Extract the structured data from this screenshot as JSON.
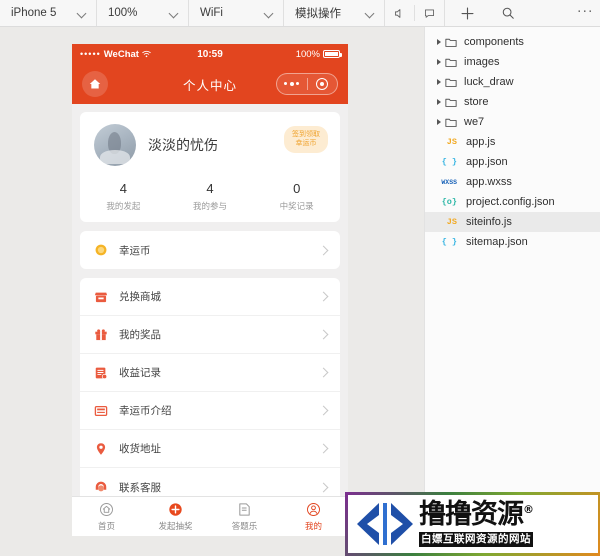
{
  "toolbar": {
    "device": "iPhone 5",
    "zoom": "100%",
    "network": "WiFi",
    "simulate": "模拟操作",
    "mute_icon": "speaker-mute-icon",
    "feedback_icon": "chat-bubble-icon",
    "add_icon": "plus-icon",
    "search_icon": "search-icon",
    "more_icon": "more-horizontal-icon"
  },
  "phone": {
    "status": {
      "signal_dots": "•••••",
      "carrier": "WeChat",
      "wifi_icon": "wifi-icon",
      "time": "10:59",
      "battery_percent": "100%",
      "battery_icon": "battery-full-icon"
    },
    "nav": {
      "home_icon": "home-icon",
      "title": "个人中心",
      "capsule_more_icon": "more-dots-icon",
      "capsule_target_icon": "target-circle-icon"
    },
    "user": {
      "avatar_icon": "user-avatar",
      "name": "淡淡的忧伤",
      "badge_line1": "签到领取",
      "badge_line2": "幸运币",
      "stats": [
        {
          "num": "4",
          "label": "我的发起"
        },
        {
          "num": "4",
          "label": "我的参与"
        },
        {
          "num": "0",
          "label": "中奖记录"
        }
      ]
    },
    "menu_group_1": [
      {
        "label": "幸运币",
        "icon": "coin-icon",
        "color": "#f5b426",
        "arrow_icon": "chevron-right-icon"
      }
    ],
    "menu_group_2": [
      {
        "label": "兑换商城",
        "icon": "shop-icon",
        "color": "#ea5b3f",
        "arrow_icon": "chevron-right-icon"
      },
      {
        "label": "我的奖品",
        "icon": "gift-icon",
        "color": "#ea5b3f",
        "arrow_icon": "chevron-right-icon"
      },
      {
        "label": "收益记录",
        "icon": "record-list-icon",
        "color": "#ea5b3f",
        "arrow_icon": "chevron-right-icon"
      },
      {
        "label": "幸运币介绍",
        "icon": "info-card-icon",
        "color": "#ea5b3f",
        "arrow_icon": "chevron-right-icon"
      },
      {
        "label": "收货地址",
        "icon": "location-pin-icon",
        "color": "#ea5b3f",
        "arrow_icon": "chevron-right-icon"
      },
      {
        "label": "联系客服",
        "icon": "headset-service-icon",
        "color": "#ea5b3f",
        "arrow_icon": "chevron-right-icon"
      }
    ],
    "tabs": [
      {
        "label": "首页",
        "icon": "home-outline-icon",
        "active": false
      },
      {
        "label": "发起抽奖",
        "icon": "plus-circle-icon",
        "active": false
      },
      {
        "label": "答题乐",
        "icon": "document-icon",
        "active": false
      },
      {
        "label": "我的",
        "icon": "person-circle-icon",
        "active": true
      }
    ]
  },
  "file_tree": [
    {
      "name": "components",
      "type": "folder",
      "icon": "folder-icon",
      "selected": false
    },
    {
      "name": "images",
      "type": "folder",
      "icon": "folder-icon",
      "selected": false
    },
    {
      "name": "luck_draw",
      "type": "folder",
      "icon": "folder-icon",
      "selected": false
    },
    {
      "name": "store",
      "type": "folder",
      "icon": "folder-icon",
      "selected": false
    },
    {
      "name": "we7",
      "type": "folder",
      "icon": "folder-icon",
      "selected": false
    },
    {
      "name": "app.js",
      "type": "file",
      "icon": "js-icon",
      "badge": "JS",
      "badge_color": "#f2ab26",
      "selected": false
    },
    {
      "name": "app.json",
      "type": "file",
      "icon": "json-icon",
      "badge": "{ }",
      "badge_color": "#3ab6e3",
      "selected": false
    },
    {
      "name": "app.wxss",
      "type": "file",
      "icon": "wxss-icon",
      "badge": "WXSS",
      "badge_color": "#1a63b8",
      "selected": false
    },
    {
      "name": "project.config.json",
      "type": "file",
      "icon": "config-icon",
      "badge": "{o}",
      "badge_color": "#2fb8a8",
      "selected": false
    },
    {
      "name": "siteinfo.js",
      "type": "file",
      "icon": "js-icon",
      "badge": "JS",
      "badge_color": "#f2ab26",
      "selected": true
    },
    {
      "name": "sitemap.json",
      "type": "file",
      "icon": "json-icon",
      "badge": "{ }",
      "badge_color": "#3ab6e3",
      "selected": false
    }
  ],
  "watermark": {
    "brand": "撸撸资源",
    "registered": "®",
    "tagline": "白嫖互联网资源的网站",
    "logo_icon": "diamond-arrows-logo"
  },
  "colors": {
    "accent_orange": "#e2451f",
    "badge_bg": "#fdecd2",
    "badge_text": "#f0a32e",
    "coin_yellow": "#f5b426",
    "icon_red": "#ea5b3f",
    "pane_bg": "#ebeae8"
  }
}
